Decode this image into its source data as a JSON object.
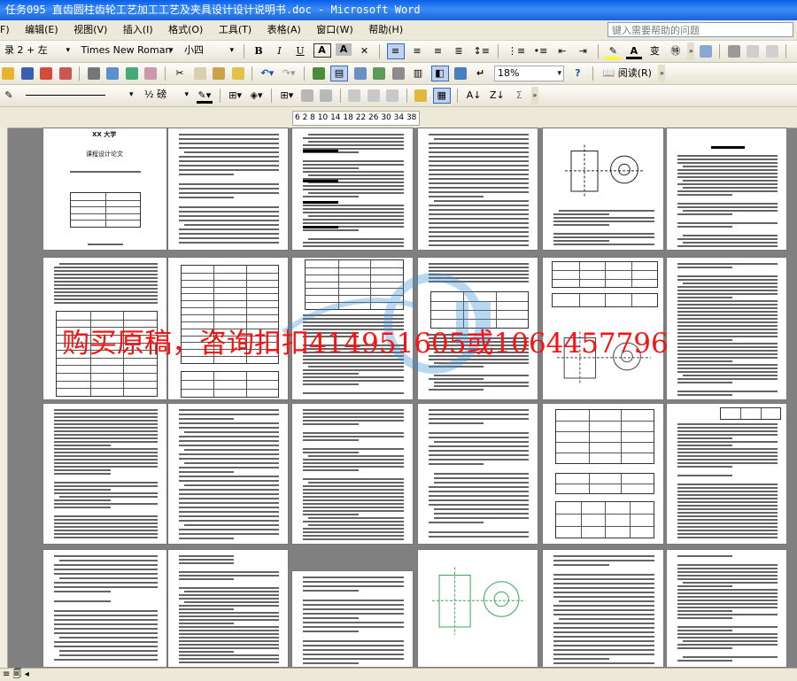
{
  "window": {
    "title": "任务095 直齿圆柱齿轮工艺加工工艺及夹具设计设计说明书.doc - Microsoft Word"
  },
  "menubar": {
    "items": [
      "F)",
      "编辑(E)",
      "视图(V)",
      "插入(I)",
      "格式(O)",
      "工具(T)",
      "表格(A)",
      "窗口(W)",
      "帮助(H)"
    ],
    "help_placeholder": "键入需要帮助的问题"
  },
  "format_toolbar": {
    "style_fragment": "录 2 + 左",
    "font_name": "Times New Roman",
    "font_size": "小四",
    "bold": "B",
    "italic": "I",
    "underline": "U"
  },
  "standard_toolbar": {
    "zoom": "18%",
    "reading_label": "阅读(R)"
  },
  "drawing_toolbar": {
    "line_weight": "½ 磅"
  },
  "ruler": {
    "text": "6  2  8 10 14 18 22 26 30 34 38 40"
  },
  "document": {
    "cover_heading": "XX 大学",
    "cover_subtitle": "课程设计论文",
    "watermark": "购买原稿，咨询扣扣414951605或1064457796"
  },
  "colors": {
    "title_bar": "#0a5ee8",
    "chrome": "#ece9d8",
    "workspace": "#808080",
    "watermark": "#ff1010"
  }
}
